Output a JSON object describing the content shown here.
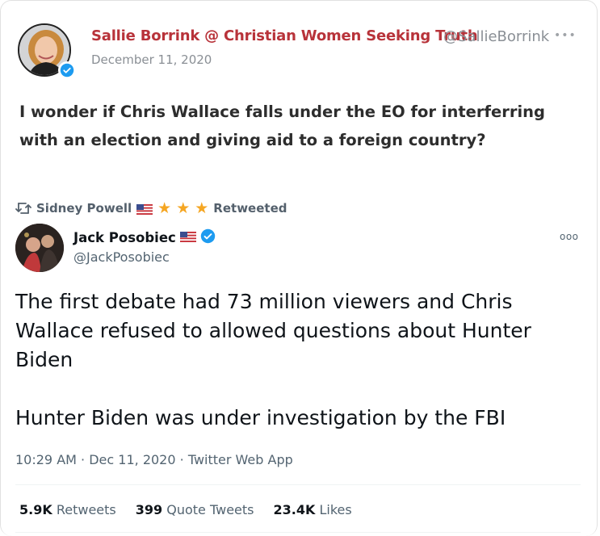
{
  "outer_tweet": {
    "display_name": "Sallie Borrink @ Christian Women Seeking Truth",
    "handle": "@SallieBorrink",
    "date": "December 11, 2020",
    "text": "I wonder if Chris Wallace falls under the EO for interferring with an election and giving aid to a foreign country?",
    "more_icon": "more-dots-icon",
    "verified_icon": "verified-badge-icon"
  },
  "retweet": {
    "icon": "retweet-icon",
    "user": "Sidney Powell",
    "label": "Retweeted",
    "star_glyph": "★"
  },
  "inner_tweet": {
    "display_name": "Jack Posobiec",
    "handle": "@JackPosobiec",
    "text": "The first debate had 73 million viewers and Chris Wallace refused to allowed questions about Hunter Biden\n\nHunter Biden was under investigation by the FBI",
    "time": "10:29 AM",
    "date": "Dec 11, 2020",
    "source": "Twitter Web App",
    "sep": "·",
    "more_glyph": "ooo"
  },
  "stats": {
    "retweets_count": "5.9K",
    "retweets_label": "Retweets",
    "quotes_count": "399",
    "quotes_label": "Quote Tweets",
    "likes_count": "23.4K",
    "likes_label": "Likes"
  },
  "colors": {
    "outer_name": "#b8333a",
    "verified": "#1d9bf0",
    "star": "#f5a623",
    "muted": "#536471"
  }
}
